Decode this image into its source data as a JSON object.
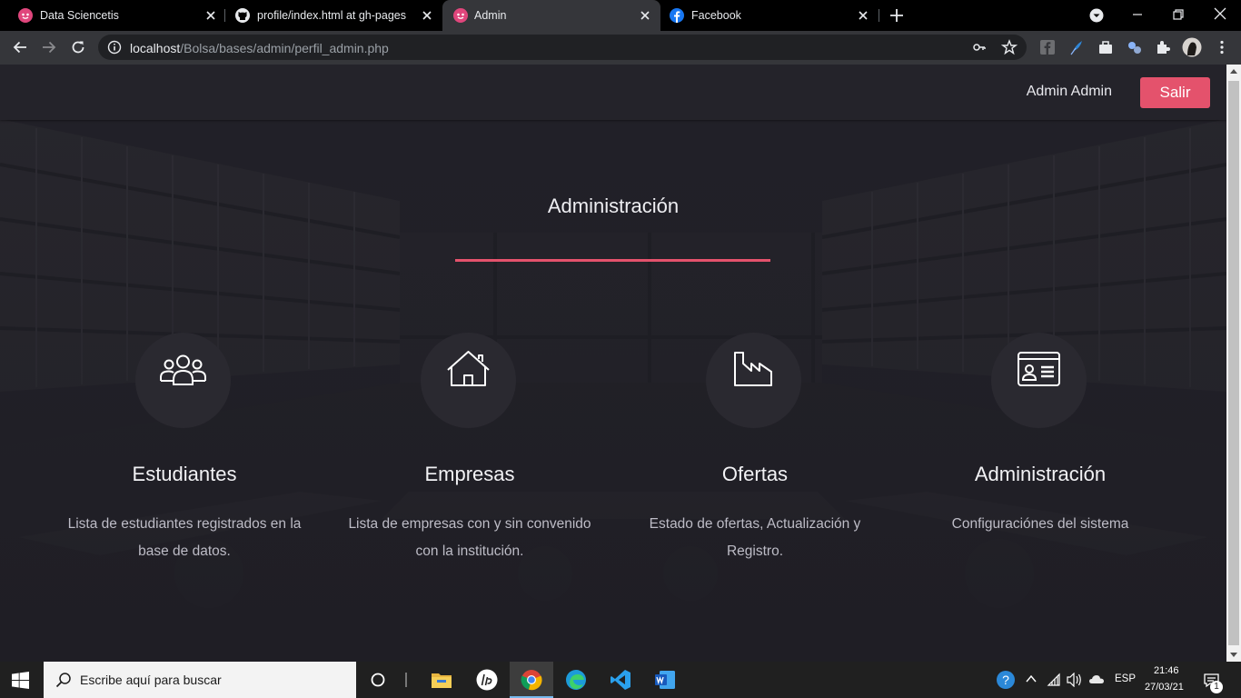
{
  "browser": {
    "tabs": [
      {
        "title": "Data Sciencetis",
        "active": false
      },
      {
        "title": "profile/index.html at gh-pages · ",
        "active": false
      },
      {
        "title": "Admin",
        "active": true
      },
      {
        "title": "Facebook",
        "active": false
      }
    ],
    "url_host": "localhost",
    "url_path": "/Bolsa/bases/admin/perfil_admin.php"
  },
  "navbar": {
    "user_name": "Admin Admin",
    "logout_label": "Salir"
  },
  "section": {
    "title": "Administración"
  },
  "cards": [
    {
      "title": "Estudiantes",
      "description": "Lista de estudiantes registrados en la base de datos.",
      "icon": "users-icon"
    },
    {
      "title": "Empresas",
      "description": "Lista de empresas con y sin convenido con la institución.",
      "icon": "house-icon"
    },
    {
      "title": "Ofertas",
      "description": "Estado de ofertas, Actualización y Registro.",
      "icon": "factory-icon"
    },
    {
      "title": "Administración",
      "description": "Configuraciónes del sistema",
      "icon": "id-card-icon"
    }
  ],
  "taskbar": {
    "search_placeholder": "Escribe aquí para buscar",
    "language": "ESP",
    "time": "21:46",
    "date": "27/03/21",
    "notification_count": "1"
  },
  "colors": {
    "accent": "#e4526c",
    "page_bg": "#1e1d24",
    "navbar_bg": "#24232a"
  }
}
